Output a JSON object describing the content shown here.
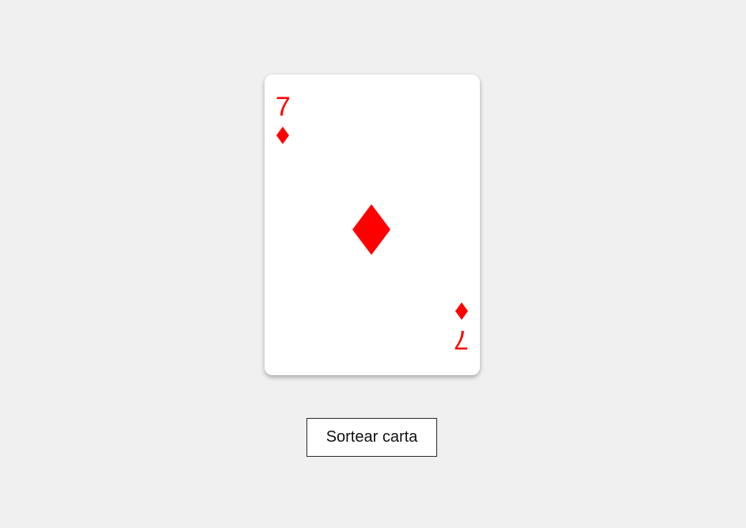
{
  "card": {
    "rank": "7",
    "suit_icon": "diamond-icon",
    "suit_color": "#ff0000"
  },
  "actions": {
    "draw_label": "Sortear carta"
  }
}
